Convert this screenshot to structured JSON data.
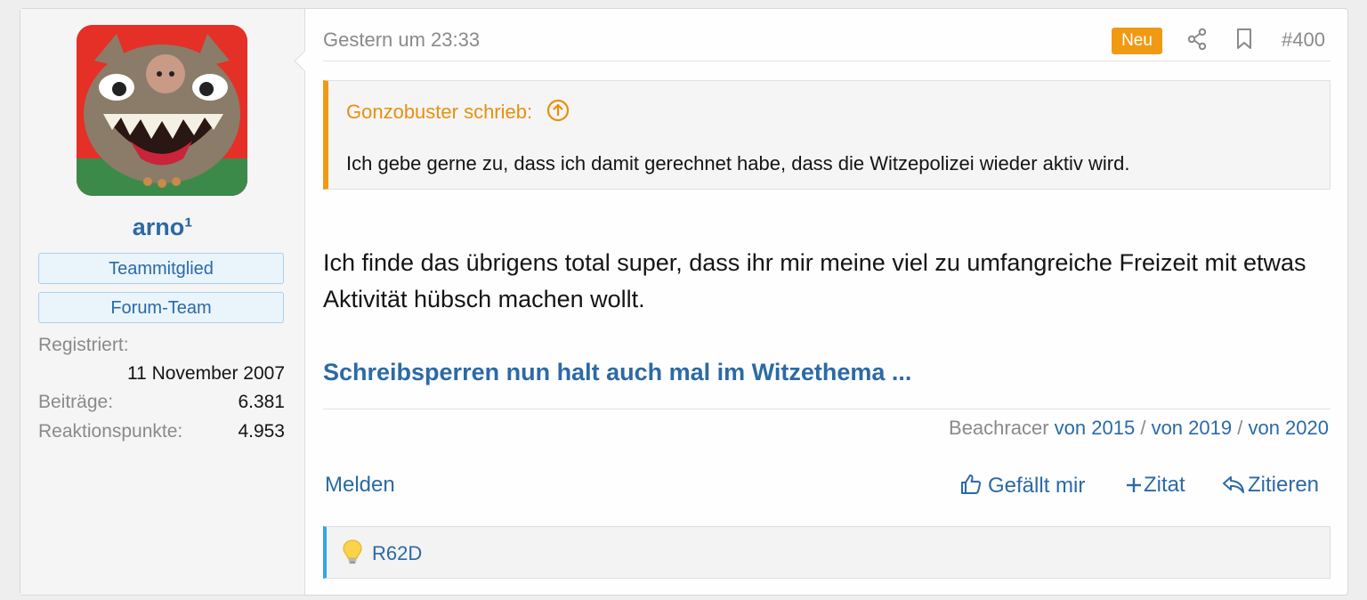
{
  "user": {
    "username": "arno¹",
    "banners": [
      "Teammitglied",
      "Forum-Team"
    ],
    "registered_label": "Registriert:",
    "registered_value": "11 November 2007",
    "posts_label": "Beiträge:",
    "posts_value": "6.381",
    "reactions_label": "Reaktionspunkte:",
    "reactions_value": "4.953"
  },
  "post": {
    "timestamp": "Gestern um 23:33",
    "new_badge": "Neu",
    "number": "#400",
    "quote": {
      "author": "Gonzobuster schrieb:",
      "text": "Ich gebe gerne zu, dass ich damit gerechnet habe, dass die Witzepolizei wieder aktiv wird."
    },
    "message": "Ich finde das übrigens total super, dass ihr mir meine viel zu umfangreiche Freizeit mit etwas Aktivität hübsch machen wollt.",
    "thread_link": "Schreibsperren nun halt auch mal im Witzethema ...",
    "signature": {
      "prefix": "Beachracer",
      "links": [
        "von 2015",
        "von 2019",
        "von 2020"
      ],
      "separator": "/"
    }
  },
  "actions": {
    "report": "Melden",
    "like": "Gefällt mir",
    "multiquote": "Zitat",
    "reply": "Zitieren"
  },
  "reactions": {
    "user": "R62D"
  },
  "colors": {
    "accent": "#2b6aa6",
    "quote_accent": "#f09a14",
    "reaction_bar": "#34a4e8"
  },
  "icons": [
    "share-icon",
    "bookmark-icon",
    "arrow-up-circle-icon",
    "thumbs-up-icon",
    "plus-icon",
    "reply-icon",
    "lightbulb-icon"
  ]
}
